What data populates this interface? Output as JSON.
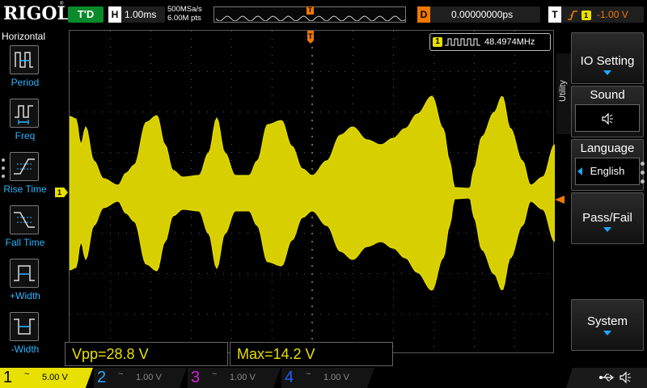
{
  "top": {
    "logo": "RIGOL",
    "run_status": "T'D",
    "timebase_key": "H",
    "timebase_value": "1.00ms",
    "sample_rate": "500MSa/s",
    "memory_depth": "6.00M pts",
    "trigger_delay_key": "D",
    "trigger_delay_value": "0.00000000ps",
    "trigger_key": "T",
    "trigger_edge_icon": "rising-edge-icon",
    "trigger_level": "-1.00 V"
  },
  "left_menu": {
    "title": "Horizontal",
    "items": [
      {
        "label": "Period",
        "icon": "period-icon"
      },
      {
        "label": "Freq",
        "icon": "frequency-icon"
      },
      {
        "label": "Rise Time",
        "icon": "rise-time-icon"
      },
      {
        "label": "Fall Time",
        "icon": "fall-time-icon"
      },
      {
        "label": "+Width",
        "icon": "positive-width-icon"
      },
      {
        "label": "-Width",
        "icon": "negative-width-icon"
      }
    ]
  },
  "screen": {
    "freq_channel": "1",
    "freq_value": "48.4974MHz",
    "channel_marker": "1"
  },
  "measurements": [
    {
      "text": "Vpp=28.8 V"
    },
    {
      "text": "Max=14.2 V"
    }
  ],
  "right_menu": {
    "tab_label": "Utility",
    "io_setting": "IO Setting",
    "sound_label": "Sound",
    "sound_icon": "speaker-icon",
    "language_label": "Language",
    "language_value": "English",
    "pass_fail": "Pass/Fail",
    "system": "System"
  },
  "bottom": {
    "channels": [
      {
        "num": "1",
        "coupling": "~",
        "scale": "5.00 V",
        "color": "#e8e000",
        "active": true
      },
      {
        "num": "2",
        "coupling": "~",
        "scale": "1.00 V",
        "color": "#2aa8ff",
        "active": false
      },
      {
        "num": "3",
        "coupling": "~",
        "scale": "1.00 V",
        "color": "#d020d0",
        "active": false
      },
      {
        "num": "4",
        "coupling": "~",
        "scale": "1.00 V",
        "color": "#2060ff",
        "active": false
      }
    ],
    "status_icons": [
      "usb-icon",
      "speaker-icon"
    ]
  },
  "colors": {
    "ch1": "#e8e000",
    "trigger": "#f07800",
    "menu_accent": "#2fb4ff"
  }
}
